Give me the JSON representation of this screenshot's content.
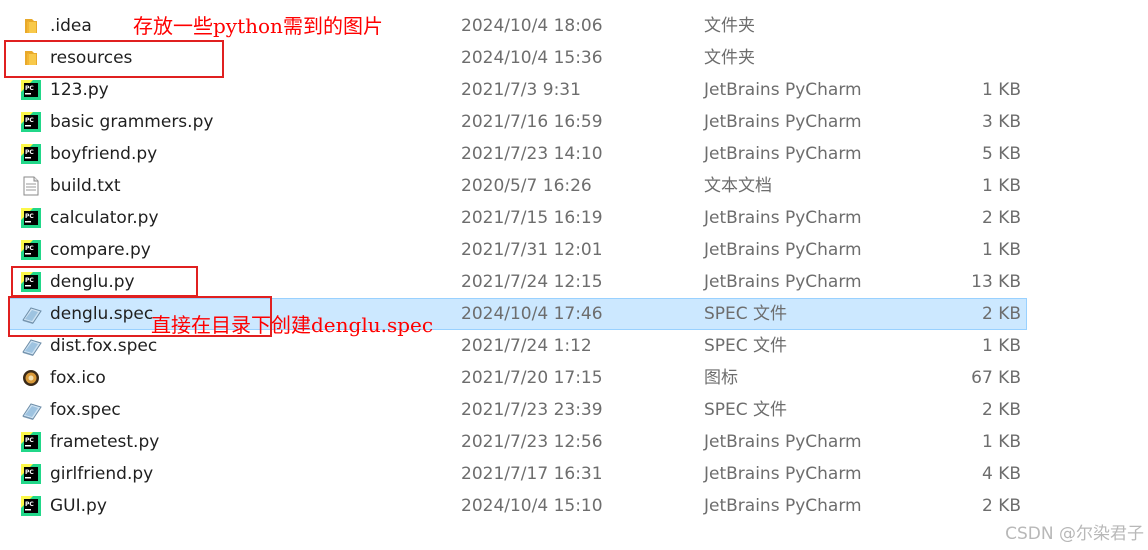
{
  "files": [
    {
      "name": ".idea",
      "date": "2024/10/4 18:06",
      "type": "文件夹",
      "size": "",
      "icon": "folder-icon"
    },
    {
      "name": "resources",
      "date": "2024/10/4 15:36",
      "type": "文件夹",
      "size": "",
      "icon": "folder-icon"
    },
    {
      "name": "123.py",
      "date": "2021/7/3 9:31",
      "type": "JetBrains PyCharm",
      "size": "1 KB",
      "icon": "pycharm-file-icon"
    },
    {
      "name": "basic grammers.py",
      "date": "2021/7/16 16:59",
      "type": "JetBrains PyCharm",
      "size": "3 KB",
      "icon": "pycharm-file-icon"
    },
    {
      "name": "boyfriend.py",
      "date": "2021/7/23 14:10",
      "type": "JetBrains PyCharm",
      "size": "5 KB",
      "icon": "pycharm-file-icon"
    },
    {
      "name": "build.txt",
      "date": "2020/5/7 16:26",
      "type": "文本文档",
      "size": "1 KB",
      "icon": "text-file-icon"
    },
    {
      "name": "calculator.py",
      "date": "2021/7/15 16:19",
      "type": "JetBrains PyCharm",
      "size": "2 KB",
      "icon": "pycharm-file-icon"
    },
    {
      "name": "compare.py",
      "date": "2021/7/31 12:01",
      "type": "JetBrains PyCharm",
      "size": "1 KB",
      "icon": "pycharm-file-icon"
    },
    {
      "name": "denglu.py",
      "date": "2021/7/24 12:15",
      "type": "JetBrains PyCharm",
      "size": "13 KB",
      "icon": "pycharm-file-icon"
    },
    {
      "name": "denglu.spec",
      "date": "2024/10/4 17:46",
      "type": "SPEC 文件",
      "size": "2 KB",
      "icon": "spec-file-icon",
      "selected": true
    },
    {
      "name": "dist.fox.spec",
      "date": "2021/7/24 1:12",
      "type": "SPEC 文件",
      "size": "1 KB",
      "icon": "spec-file-icon"
    },
    {
      "name": "fox.ico",
      "date": "2021/7/20 17:15",
      "type": "图标",
      "size": "67 KB",
      "icon": "fox-ico-icon"
    },
    {
      "name": "fox.spec",
      "date": "2021/7/23 23:39",
      "type": "SPEC 文件",
      "size": "2 KB",
      "icon": "spec-file-icon"
    },
    {
      "name": "frametest.py",
      "date": "2021/7/23 12:56",
      "type": "JetBrains PyCharm",
      "size": "1 KB",
      "icon": "pycharm-file-icon"
    },
    {
      "name": "girlfriend.py",
      "date": "2021/7/17 16:31",
      "type": "JetBrains PyCharm",
      "size": "4 KB",
      "icon": "pycharm-file-icon"
    },
    {
      "name": "GUI.py",
      "date": "2024/10/4 15:10",
      "type": "JetBrains PyCharm",
      "size": "2 KB",
      "icon": "pycharm-file-icon"
    }
  ],
  "annotations": {
    "resources_note": "存放一些python需到的图片",
    "spec_note": "直接在目录下创建denglu.spec"
  },
  "watermark": "CSDN @尔染君子",
  "colors": {
    "selection_bg": "#cce8ff",
    "selection_border": "#99d1ff",
    "annotation_red": "#ff0000",
    "folder_yellow": "#f8c94a",
    "pycharm_green": "#21d789"
  }
}
